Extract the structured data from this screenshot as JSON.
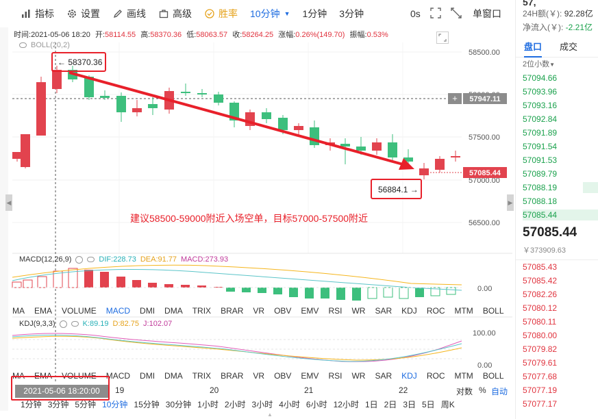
{
  "toolbar": {
    "items": [
      {
        "label": "指标",
        "icon": "bar-chart-icon"
      },
      {
        "label": "设置",
        "icon": "gear-icon"
      },
      {
        "label": "画线",
        "icon": "pencil-icon"
      },
      {
        "label": "高级",
        "icon": "briefcase-icon"
      },
      {
        "label": "胜率",
        "icon": "target-icon"
      }
    ],
    "interval": "10分钟",
    "quick_intervals": [
      "1分钟",
      "3分钟"
    ],
    "right_label": "0s",
    "window_label": "单窗口"
  },
  "info": {
    "time_label": "时间:",
    "time": "2021-05-06 18:20",
    "open_label": "开:",
    "open": "58114.55",
    "high_label": "高:",
    "high": "58370.36",
    "low_label": "低:",
    "low": "58063.57",
    "close_label": "收:",
    "close": "58264.25",
    "change_label": "涨幅:",
    "change": "0.26%(149.70)",
    "amp_label": "振幅:",
    "amp": "0.53%"
  },
  "boll_legend": "BOLL(20,2)",
  "price_axis": [
    "58500.00",
    "58000.00",
    "57500.00",
    "57000.00",
    "56500.00"
  ],
  "crosshair_price": "57947.11",
  "crosshair_plus": "+",
  "last_price_tag": "57085.44",
  "annotations": {
    "high_marker": "← 58370.36",
    "low_marker": "56884.1 →",
    "advice": "建议58500-59000附近入场空单，目标57000-57500附近"
  },
  "colors": {
    "up": "#e2434e",
    "down": "#3dbf7d",
    "arrow": "#e8202a",
    "accent": "#1e6ce0"
  },
  "macd_legend": {
    "name": "MACD(12,26,9)",
    "dif": "DIF:228.73",
    "dea": "DEA:91.77",
    "macd": "MACD:273.93"
  },
  "macd_axis": [
    "0.00"
  ],
  "kdj_legend": {
    "name": "KDJ(9,3,3)",
    "k": "K:89.19",
    "d": "D:82.75",
    "j": "J:102.07"
  },
  "kdj_axis": [
    "100.00",
    "0.00"
  ],
  "indicator_tabs_1": [
    "MA",
    "EMA",
    "VOLUME",
    "MACD",
    "DMI",
    "DMA",
    "TRIX",
    "BRAR",
    "VR",
    "OBV",
    "EMV",
    "RSI",
    "WR",
    "SAR",
    "KDJ",
    "ROC",
    "MTM",
    "BOLL"
  ],
  "indicator_tabs_1_active": "MACD",
  "indicator_tabs_2": [
    "MA",
    "EMA",
    "VOLUME",
    "MACD",
    "DMI",
    "DMA",
    "TRIX",
    "BRAR",
    "VR",
    "OBV",
    "EMV",
    "RSI",
    "WR",
    "SAR",
    "KDJ",
    "ROC",
    "MTM",
    "BOLL"
  ],
  "indicator_tabs_2_active": "KDJ",
  "date_axis": {
    "selected": "2021-05-06 18:20:00",
    "labels": [
      "19",
      "20",
      "21",
      "22"
    ],
    "right": [
      "对数",
      "%",
      "自动"
    ]
  },
  "periods": [
    "1分钟",
    "3分钟",
    "5分钟",
    "10分钟",
    "15分钟",
    "30分钟",
    "1小时",
    "2小时",
    "3小时",
    "4小时",
    "6小时",
    "12小时",
    "1日",
    "2日",
    "3日",
    "5日",
    "周K"
  ],
  "periods_active": "10分钟",
  "right_panel": {
    "top_partial": "57,",
    "amount_label": "24H额(￥):",
    "amount": "92.28亿",
    "inflow_label": "净流入(￥):",
    "inflow": "-2.21亿",
    "tabs": [
      "盘口",
      "成交"
    ],
    "decimals": "2位小数",
    "asks": [
      "57094.66",
      "57093.96",
      "57093.16",
      "57092.84",
      "57091.89",
      "57091.54",
      "57091.53",
      "57089.79",
      "57088.19",
      "57088.18",
      "57085.44"
    ],
    "last": "57085.44",
    "last_cny": "￥373909.63",
    "bids": [
      "57085.43",
      "57085.42",
      "57082.26",
      "57080.12",
      "57080.11",
      "57080.00",
      "57079.82",
      "57079.61",
      "57077.68",
      "57077.19",
      "57077.17"
    ]
  }
}
